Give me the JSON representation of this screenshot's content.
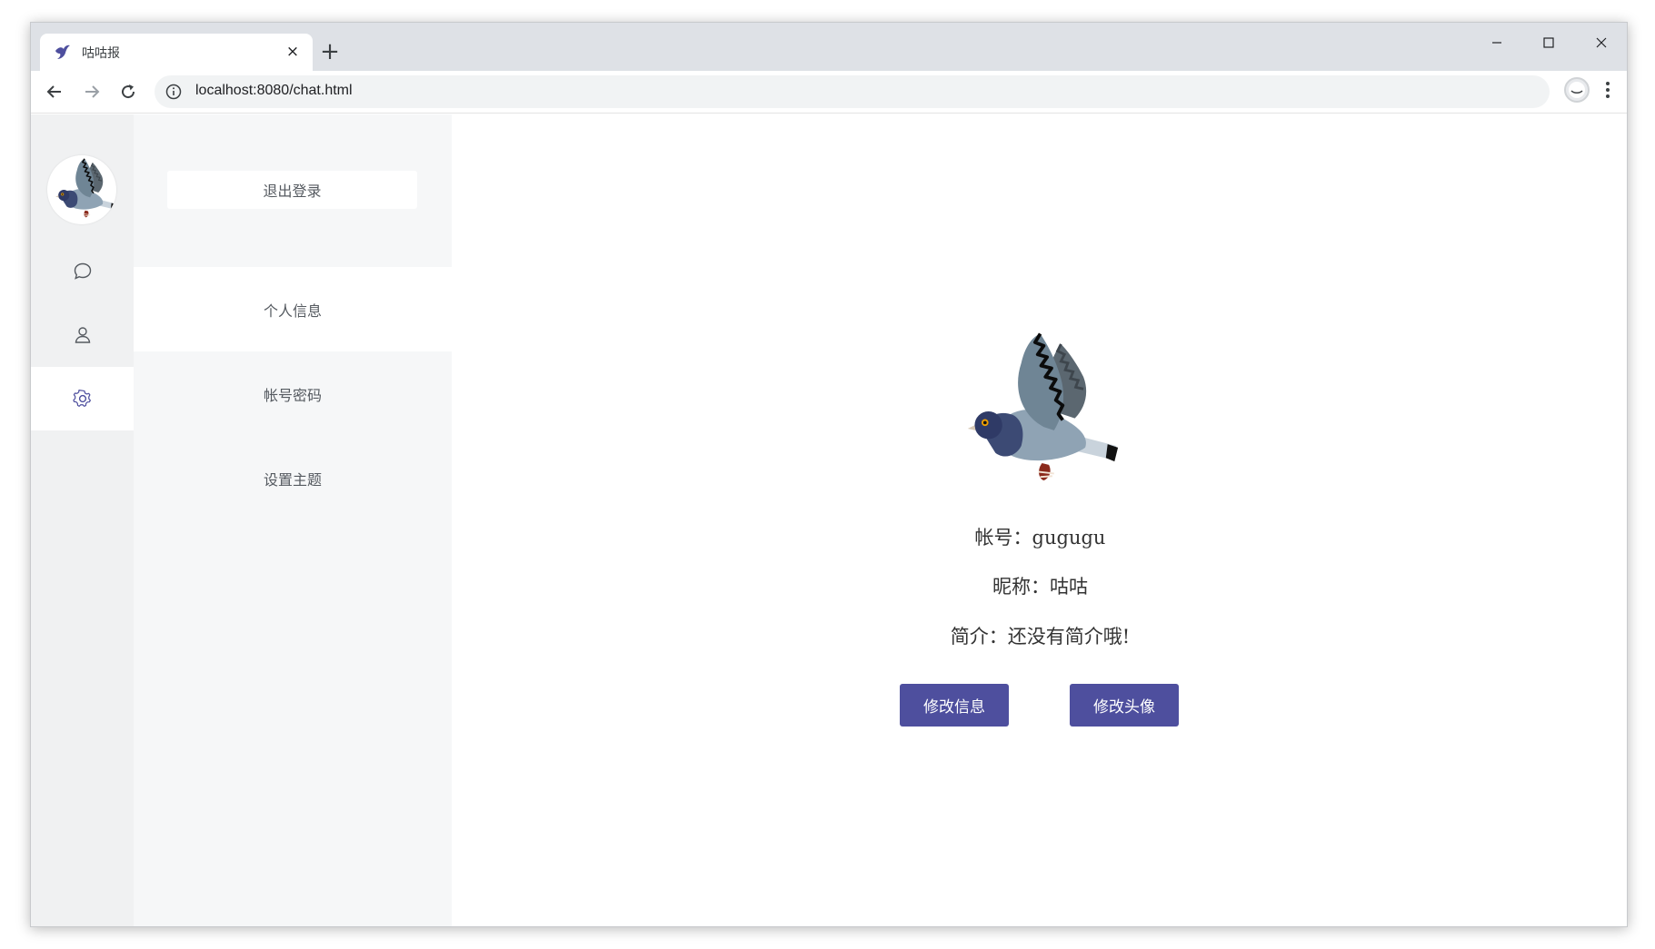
{
  "browser": {
    "tab_title": "咕咕报",
    "tab_close": "×",
    "new_tab": "+",
    "url": "localhost:8080/chat.html",
    "icons": [
      "favicon-dove-icon",
      "back-arrow-icon",
      "forward-arrow-icon",
      "reload-icon",
      "info-icon",
      "star-icon",
      "profile-icon",
      "menu-kebab-icon",
      "minimize-icon",
      "maximize-icon",
      "close-icon"
    ]
  },
  "rail": {
    "avatar": "pigeon-avatar",
    "items": [
      {
        "name": "chat",
        "icon": "chat-bubble-icon"
      },
      {
        "name": "contacts",
        "icon": "user-icon"
      },
      {
        "name": "settings",
        "icon": "gear-icon",
        "active": true
      }
    ]
  },
  "menu": {
    "logout": "退出登录",
    "items": [
      {
        "label": "个人信息",
        "active": true
      },
      {
        "label": "帐号密码",
        "active": false
      },
      {
        "label": "设置主题",
        "active": false
      }
    ]
  },
  "profile": {
    "account_line": "帐号：gugugu",
    "nickname_line": "昵称：咕咕",
    "bio_line": "简介：还没有简介哦!",
    "edit_info": "修改信息",
    "edit_avatar": "修改头像"
  },
  "colors": {
    "primary": "#4e4f9e",
    "rail_bg": "#f0f1f2",
    "menu_bg": "#f6f7f8",
    "titlebar_bg": "#dee1e6"
  }
}
